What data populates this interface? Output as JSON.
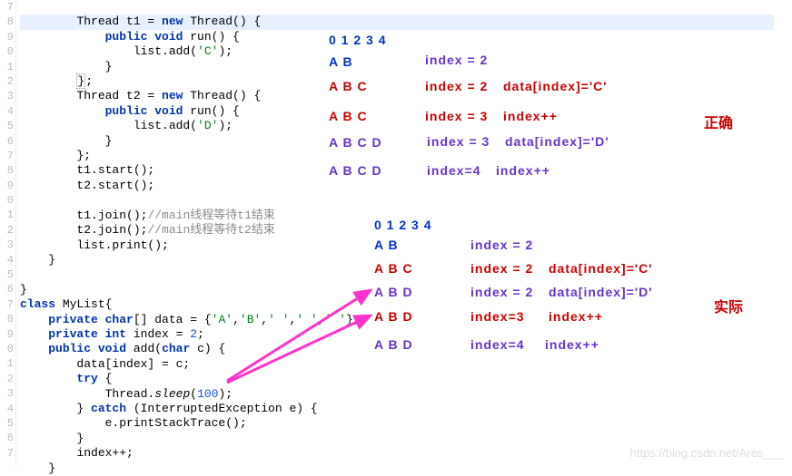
{
  "gutter": [
    "7",
    "8",
    "9",
    "0",
    "1",
    "2",
    "3",
    "4",
    "5",
    "6",
    "7",
    "8",
    "9",
    "0",
    "1",
    "2",
    "3",
    "4",
    "5",
    "6",
    "7",
    "8",
    "9",
    "0",
    "1",
    "2",
    "3",
    "4",
    "5",
    "6",
    "7"
  ],
  "code": {
    "l1": "        Thread t1 = new Thread() {",
    "l2": "            public void run() {",
    "l3": "                list.add('C');",
    "l4": "            }",
    "l5": "        };",
    "l6": "        Thread t2 = new Thread() {",
    "l7": "            public void run() {",
    "l8": "                list.add('D');",
    "l9": "            }",
    "l10": "        };",
    "l11": "        t1.start();",
    "l12": "        t2.start();",
    "l13": "",
    "l14": "        t1.join();//main线程等待t1结束",
    "l15": "        t2.join();//main线程等待t2结束",
    "l16": "        list.print();",
    "l17": "    }",
    "l18": "",
    "l19": "}",
    "l20": "class MyList{",
    "l21": "    private char[] data = {'A','B',' ',' ',' '};",
    "l22": "    private int index = 2;",
    "l23": "    public void add(char c) {",
    "l24": "        data[index] = c;",
    "l25": "        try {",
    "l26": "            Thread.sleep(100);",
    "l27": "        } catch (InterruptedException e) {",
    "l28": "            e.printStackTrace();",
    "l29": "        }",
    "l30": "        index++;",
    "l31": "    }"
  },
  "top": {
    "header": "0 1 2 3 4",
    "r1a": "A B",
    "r1b": "index = 2",
    "r2a": "A B C",
    "r2b": "index = 2",
    "r2c": "data[index]='C'",
    "r3a": "A B C",
    "r3b": "index = 3",
    "r3c": "index++",
    "r4a": "A B C D",
    "r4b": "index = 3",
    "r4c": "data[index]='D'",
    "r5a": "A B C D",
    "r5b": "index=4",
    "r5c": "index++"
  },
  "bot": {
    "header": "0 1 2 3 4",
    "r1a": "A B",
    "r1b": "index = 2",
    "r2a": "A B C",
    "r2b": "index = 2",
    "r2c": "data[index]='C'",
    "r3a": "A B D",
    "r3b": "index = 2",
    "r3c": "data[index]='D'",
    "r4a": "A B D",
    "r4b": "index=3",
    "r4c": "index++",
    "r5a": "A B D",
    "r5b": "index=4",
    "r5c": "index++"
  },
  "label_top": "正确",
  "label_bot": "实际",
  "watermark": "https://blog.csdn.net/Ares___"
}
